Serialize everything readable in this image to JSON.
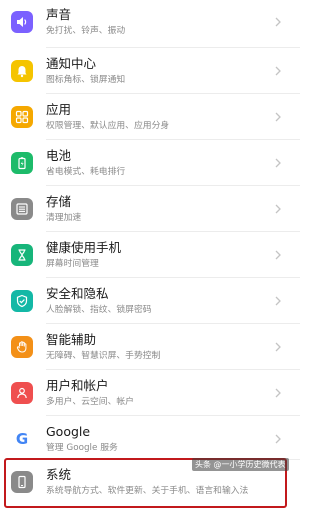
{
  "settings": {
    "items": [
      {
        "title": "声音",
        "subtitle": "免打扰、铃声、振动",
        "icon": "sound-icon",
        "color": "#7b61ff"
      },
      {
        "title": "通知中心",
        "subtitle": "图标角标、锁屏通知",
        "icon": "bell-icon",
        "color": "#f5c400"
      },
      {
        "title": "应用",
        "subtitle": "权限管理、默认应用、应用分身",
        "icon": "apps-grid-icon",
        "color": "#f5a800"
      },
      {
        "title": "电池",
        "subtitle": "省电模式、耗电排行",
        "icon": "battery-icon",
        "color": "#1dbb6a"
      },
      {
        "title": "存储",
        "subtitle": "清理加速",
        "icon": "storage-icon",
        "color": "#8a8a8a"
      },
      {
        "title": "健康使用手机",
        "subtitle": "屏幕时间管理",
        "icon": "hourglass-icon",
        "color": "#17b57a"
      },
      {
        "title": "安全和隐私",
        "subtitle": "人脸解锁、指纹、锁屏密码",
        "icon": "shield-icon",
        "color": "#13b8a6"
      },
      {
        "title": "智能辅助",
        "subtitle": "无障碍、智慧识屏、手势控制",
        "icon": "hand-icon",
        "color": "#f39018"
      },
      {
        "title": "用户和帐户",
        "subtitle": "多用户、云空间、帐户",
        "icon": "user-icon",
        "color": "#ef4f4f"
      },
      {
        "title": "Google",
        "subtitle": "管理 Google 服务",
        "icon": "google-icon",
        "color": "#ffffff"
      },
      {
        "title": "系统",
        "subtitle": "系统导航方式、软件更新、关于手机、语言和输入法",
        "icon": "phone-icon",
        "color": "#8a8a8a"
      }
    ]
  },
  "watermark": {
    "text": "头条 @一小学历史微代表"
  }
}
